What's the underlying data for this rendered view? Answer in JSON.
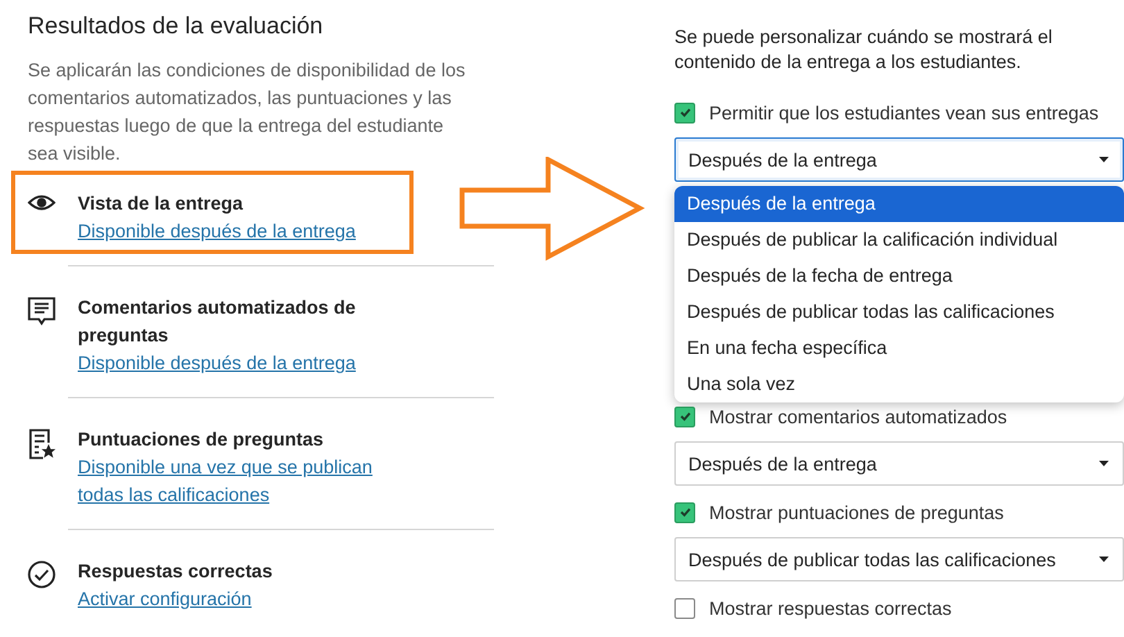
{
  "section": {
    "title": "Resultados de la evaluación",
    "description": "Se aplicarán las condiciones de disponibilidad de los comentarios automatizados, las puntuaciones y las respuestas luego de que la entrega del estudiante sea visible."
  },
  "items": [
    {
      "title": "Vista de la entrega",
      "link": "Disponible después de la entrega",
      "highlighted": true
    },
    {
      "title": "Comentarios automatizados de preguntas",
      "link": "Disponible después de la entrega",
      "highlighted": false
    },
    {
      "title": "Puntuaciones de preguntas",
      "link": "Disponible una vez que se publican todas las calificaciones",
      "highlighted": false
    },
    {
      "title": "Respuestas correctas",
      "link": "Activar configuración",
      "highlighted": false
    }
  ],
  "settings": {
    "intro": "Se puede personalizar cuándo se mostrará el contenido de la entrega a los estudiantes.",
    "controls": [
      {
        "kind": "checkbox",
        "label": "Permitir que los estudiantes vean sus entregas",
        "checked": true
      },
      {
        "kind": "select",
        "value": "Después de la entrega",
        "expanded": true,
        "options": [
          {
            "label": "Después de la entrega",
            "selected": true
          },
          {
            "label": "Después de publicar la calificación individual",
            "selected": false
          },
          {
            "label": "Después de la fecha de entrega",
            "selected": false
          },
          {
            "label": "Después de publicar todas las calificaciones",
            "selected": false
          },
          {
            "label": "En una fecha específica",
            "selected": false
          },
          {
            "label": "Una sola vez",
            "selected": false
          }
        ]
      },
      {
        "kind": "checkbox",
        "label": "Mostrar comentarios automatizados",
        "checked": true
      },
      {
        "kind": "select",
        "value": "Después de la entrega",
        "expanded": false
      },
      {
        "kind": "checkbox",
        "label": "Mostrar puntuaciones de preguntas",
        "checked": true
      },
      {
        "kind": "select",
        "value": "Después de publicar todas las calificaciones",
        "expanded": false
      },
      {
        "kind": "checkbox",
        "label": "Mostrar respuestas correctas",
        "checked": false
      }
    ]
  }
}
